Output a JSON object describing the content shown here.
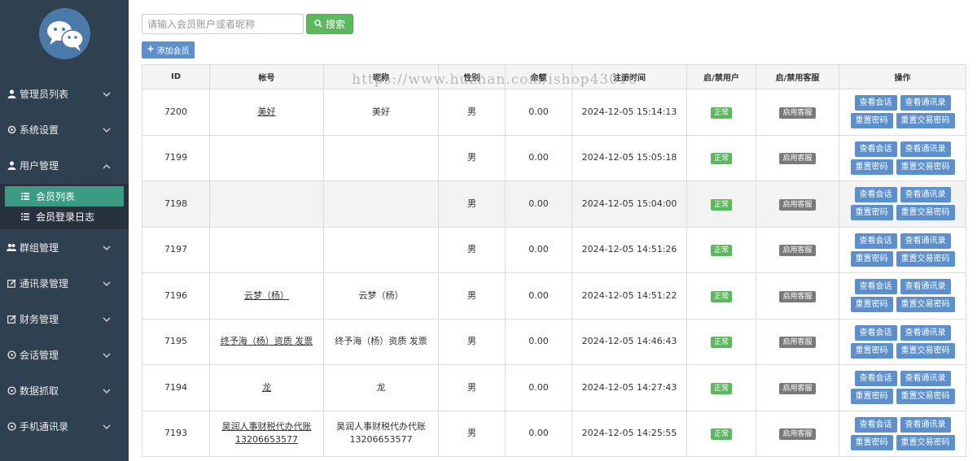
{
  "sidebar": {
    "items": [
      {
        "label": "管理员列表",
        "icon": "user-icon"
      },
      {
        "label": "系统设置",
        "icon": "gear-icon"
      },
      {
        "label": "用户管理",
        "icon": "user-icon"
      },
      {
        "label": "群组管理",
        "icon": "users-icon"
      },
      {
        "label": "通讯录管理",
        "icon": "edit-icon"
      },
      {
        "label": "财务管理",
        "icon": "edit-icon"
      },
      {
        "label": "会话管理",
        "icon": "chat-icon"
      },
      {
        "label": "数据抓取",
        "icon": "chat-icon"
      },
      {
        "label": "手机通讯录",
        "icon": "chat-icon"
      }
    ],
    "subitems": [
      {
        "label": "会员列表",
        "icon": "list-icon"
      },
      {
        "label": "会员登录日志",
        "icon": "list-icon"
      }
    ]
  },
  "toolbar": {
    "search_placeholder": "请输入会员账户或者昵称",
    "search_label": "搜索",
    "add_label": "添加会员"
  },
  "watermark": "https://www.huzhan.com/ishop43010",
  "table": {
    "headers": [
      "ID",
      "帐号",
      "昵称",
      "性别",
      "余额",
      "注册时间",
      "启/禁用户",
      "启/禁用客服",
      "操作"
    ],
    "rows": [
      {
        "id": "7200",
        "account": "美好",
        "nickname": "美好",
        "gender": "男",
        "balance": "0.00",
        "time": "2024-12-05 15:14:13",
        "status": "正常",
        "service": "启用客服"
      },
      {
        "id": "7199",
        "account": "",
        "nickname": "",
        "gender": "男",
        "balance": "0.00",
        "time": "2024-12-05 15:05:18",
        "status": "正常",
        "service": "启用客服"
      },
      {
        "id": "7198",
        "account": "",
        "nickname": "",
        "gender": "男",
        "balance": "0.00",
        "time": "2024-12-05 15:04:00",
        "status": "正常",
        "service": "启用客服"
      },
      {
        "id": "7197",
        "account": "",
        "nickname": "",
        "gender": "男",
        "balance": "0.00",
        "time": "2024-12-05 14:51:26",
        "status": "正常",
        "service": "启用客服"
      },
      {
        "id": "7196",
        "account": "云梦（杨）",
        "nickname": "云梦（杨）",
        "gender": "男",
        "balance": "0.00",
        "time": "2024-12-05 14:51:22",
        "status": "正常",
        "service": "启用客服"
      },
      {
        "id": "7195",
        "account": "终予海（杨）资质 发票",
        "nickname": "终予海（杨）资质 发票",
        "gender": "男",
        "balance": "0.00",
        "time": "2024-12-05 14:46:43",
        "status": "正常",
        "service": "启用客服"
      },
      {
        "id": "7194",
        "account": "龙",
        "nickname": "龙",
        "gender": "男",
        "balance": "0.00",
        "time": "2024-12-05 14:27:43",
        "status": "正常",
        "service": "启用客服"
      },
      {
        "id": "7193",
        "account": "昊润人事财税代办代账 13206653577",
        "nickname": "昊润人事财税代办代账 13206653577",
        "gender": "男",
        "balance": "0.00",
        "time": "2024-12-05 14:25:55",
        "status": "正常",
        "service": "启用客服"
      }
    ],
    "ops": [
      "查看会话",
      "查看通讯录",
      "重置密码",
      "重置交易密码"
    ]
  },
  "colors": {
    "sidebar": "#2f4050",
    "active": "#3b9b85",
    "primary": "#5b8fce",
    "success": "#5cb85c"
  }
}
